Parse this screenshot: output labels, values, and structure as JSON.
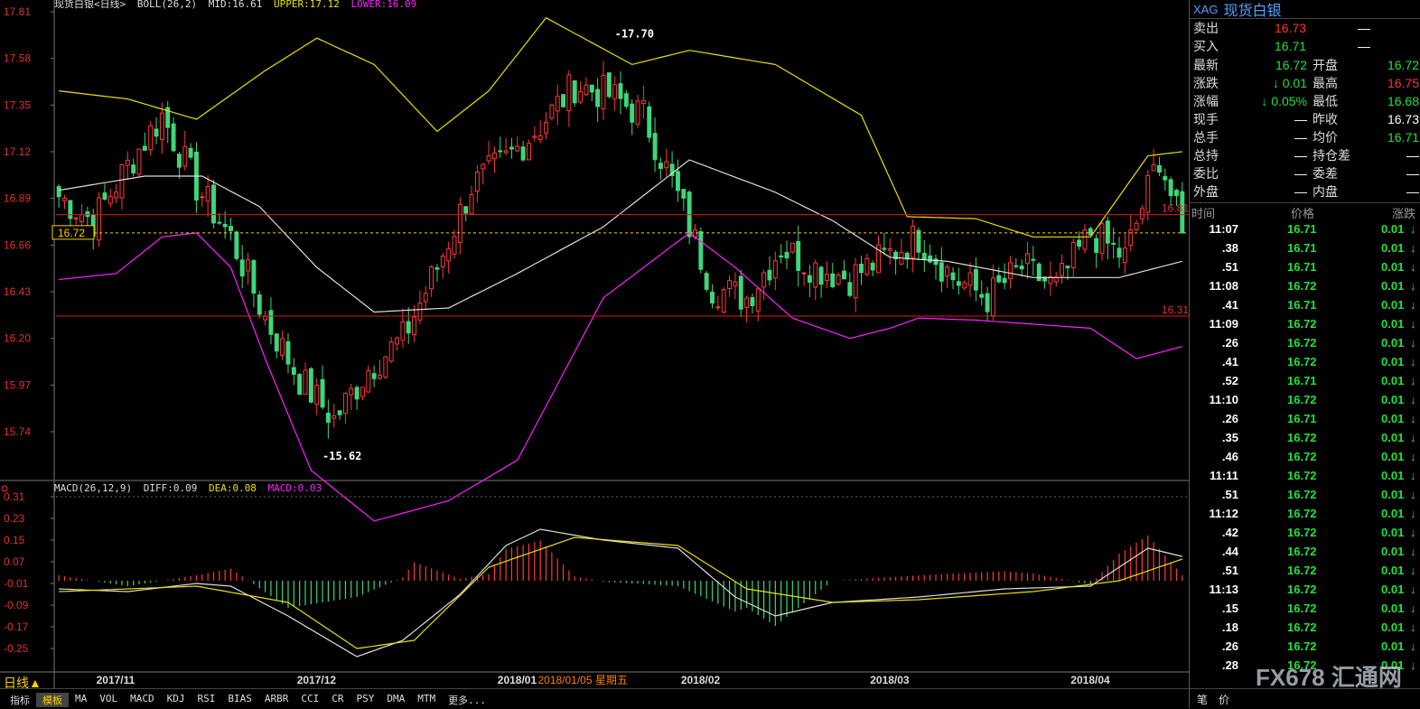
{
  "chart_header": {
    "symbol": "现货白银<日线>",
    "indicator": "BOLL(26,2)",
    "mid": "MID:16.61",
    "upper": "UPPER:17.12",
    "lower": "LOWER:16.09"
  },
  "macd_header": {
    "name": "MACD(26,12,9)",
    "diff": "DIFF:0.09",
    "dea": "DEA:0.08",
    "macd": "MACD:0.03"
  },
  "chart_data": {
    "type": "candlestick",
    "price_axis": {
      "ticks": [
        "17.81",
        "17.58",
        "17.35",
        "17.12",
        "16.89",
        "16.66",
        "16.43",
        "16.20",
        "15.97",
        "15.74"
      ],
      "range": [
        15.55,
        17.81
      ]
    },
    "macd_axis": {
      "ticks": [
        "0.31",
        "0.23",
        "0.15",
        "0.07",
        "-0.01",
        "-0.09",
        "-0.17",
        "-0.25"
      ],
      "range": [
        -0.32,
        0.31
      ]
    },
    "date_labels": [
      "2017/11",
      "2017/12",
      "2018/01",
      "2018/02",
      "2018/03",
      "2018/04"
    ],
    "cursor_date": "2018/01/05 星期五",
    "annotations": {
      "high": "17.70",
      "low": "15.62",
      "last": "16.72",
      "hline_upper": "16.81",
      "hline_lower": "16.31"
    },
    "close_anchors": [
      [
        0,
        16.9
      ],
      [
        6,
        16.78
      ],
      [
        12,
        17.05
      ],
      [
        18,
        17.3
      ],
      [
        24,
        16.95
      ],
      [
        30,
        16.7
      ],
      [
        36,
        16.3
      ],
      [
        42,
        16.0
      ],
      [
        48,
        15.8
      ],
      [
        54,
        16.05
      ],
      [
        60,
        16.2
      ],
      [
        66,
        16.55
      ],
      [
        72,
        16.95
      ],
      [
        78,
        17.08
      ],
      [
        84,
        17.25
      ],
      [
        90,
        17.45
      ],
      [
        96,
        17.4
      ],
      [
        102,
        17.3
      ],
      [
        108,
        16.9
      ],
      [
        114,
        16.45
      ],
      [
        120,
        16.4
      ],
      [
        126,
        16.65
      ],
      [
        132,
        16.55
      ],
      [
        138,
        16.5
      ],
      [
        144,
        16.6
      ],
      [
        150,
        16.7
      ],
      [
        156,
        16.5
      ],
      [
        162,
        16.4
      ],
      [
        168,
        16.55
      ],
      [
        174,
        16.45
      ],
      [
        180,
        16.72
      ],
      [
        186,
        16.6
      ],
      [
        192,
        17.1
      ],
      [
        196,
        16.72
      ]
    ],
    "upper_band": [
      [
        0,
        17.42
      ],
      [
        12,
        17.38
      ],
      [
        24,
        17.28
      ],
      [
        36,
        17.52
      ],
      [
        45,
        17.68
      ],
      [
        55,
        17.55
      ],
      [
        66,
        17.22
      ],
      [
        75,
        17.42
      ],
      [
        85,
        17.78
      ],
      [
        100,
        17.55
      ],
      [
        110,
        17.62
      ],
      [
        125,
        17.55
      ],
      [
        140,
        17.3
      ],
      [
        148,
        16.8
      ],
      [
        160,
        16.79
      ],
      [
        170,
        16.7
      ],
      [
        180,
        16.7
      ],
      [
        190,
        17.1
      ],
      [
        196,
        17.12
      ]
    ],
    "mid_band": [
      [
        0,
        16.93
      ],
      [
        15,
        17.0
      ],
      [
        25,
        17.0
      ],
      [
        35,
        16.85
      ],
      [
        45,
        16.55
      ],
      [
        55,
        16.33
      ],
      [
        68,
        16.35
      ],
      [
        80,
        16.52
      ],
      [
        95,
        16.75
      ],
      [
        110,
        17.08
      ],
      [
        125,
        16.92
      ],
      [
        135,
        16.78
      ],
      [
        145,
        16.6
      ],
      [
        155,
        16.58
      ],
      [
        170,
        16.5
      ],
      [
        185,
        16.5
      ],
      [
        196,
        16.58
      ]
    ],
    "lower_band": [
      [
        0,
        16.49
      ],
      [
        10,
        16.52
      ],
      [
        18,
        16.7
      ],
      [
        24,
        16.72
      ],
      [
        30,
        16.55
      ],
      [
        36,
        16.1
      ],
      [
        44,
        15.55
      ],
      [
        55,
        15.3
      ],
      [
        68,
        15.4
      ],
      [
        80,
        15.6
      ],
      [
        95,
        16.4
      ],
      [
        110,
        16.72
      ],
      [
        118,
        16.55
      ],
      [
        128,
        16.3
      ],
      [
        138,
        16.2
      ],
      [
        145,
        16.25
      ],
      [
        150,
        16.3
      ],
      [
        160,
        16.29
      ],
      [
        170,
        16.27
      ],
      [
        180,
        16.25
      ],
      [
        188,
        16.1
      ],
      [
        196,
        16.16
      ]
    ],
    "diff_line": [
      [
        0,
        -0.03
      ],
      [
        12,
        -0.04
      ],
      [
        24,
        -0.01
      ],
      [
        30,
        -0.02
      ],
      [
        40,
        -0.13
      ],
      [
        52,
        -0.28
      ],
      [
        60,
        -0.22
      ],
      [
        70,
        -0.05
      ],
      [
        78,
        0.13
      ],
      [
        84,
        0.19
      ],
      [
        95,
        0.15
      ],
      [
        108,
        0.12
      ],
      [
        118,
        -0.06
      ],
      [
        125,
        -0.13
      ],
      [
        135,
        -0.08
      ],
      [
        150,
        -0.06
      ],
      [
        165,
        -0.03
      ],
      [
        180,
        -0.02
      ],
      [
        190,
        0.12
      ],
      [
        196,
        0.09
      ]
    ],
    "dea_line": [
      [
        0,
        -0.04
      ],
      [
        24,
        -0.02
      ],
      [
        40,
        -0.08
      ],
      [
        52,
        -0.25
      ],
      [
        62,
        -0.22
      ],
      [
        75,
        0.05
      ],
      [
        90,
        0.16
      ],
      [
        108,
        0.13
      ],
      [
        120,
        -0.03
      ],
      [
        135,
        -0.08
      ],
      [
        150,
        -0.07
      ],
      [
        170,
        -0.04
      ],
      [
        185,
        0.0
      ],
      [
        196,
        0.08
      ]
    ]
  },
  "quote": {
    "code": "XAG",
    "name": "现货白银",
    "ask_label": "卖出",
    "ask": "16.73",
    "ask_vol": "—",
    "bid_label": "买入",
    "bid": "16.71",
    "bid_vol": "—",
    "rows": [
      {
        "l1": "最新",
        "v1": "16.72",
        "c1": "green",
        "l2": "开盘",
        "v2": "16.72",
        "c2": "green"
      },
      {
        "l1": "涨跌",
        "v1": "↓ 0.01",
        "c1": "green",
        "l2": "最高",
        "v2": "16.75",
        "c2": "red"
      },
      {
        "l1": "涨幅",
        "v1": "↓ 0.05%",
        "c1": "green",
        "l2": "最低",
        "v2": "16.68",
        "c2": "green"
      },
      {
        "l1": "现手",
        "v1": "—",
        "c1": "white",
        "l2": "昨收",
        "v2": "16.73",
        "c2": "white"
      },
      {
        "l1": "总手",
        "v1": "—",
        "c1": "white",
        "l2": "均价",
        "v2": "16.71",
        "c2": "green"
      },
      {
        "l1": "总持",
        "v1": "—",
        "c1": "white",
        "l2": "持仓差",
        "v2": "—",
        "c2": "white"
      },
      {
        "l1": "委比",
        "v1": "—",
        "c1": "white",
        "l2": "委差",
        "v2": "—",
        "c2": "white"
      },
      {
        "l1": "外盘",
        "v1": "—",
        "c1": "white",
        "l2": "内盘",
        "v2": "—",
        "c2": "white"
      }
    ]
  },
  "ticks_header": {
    "time": "时间",
    "price": "价格",
    "change": "涨跌"
  },
  "ticks": [
    {
      "t": "11:07",
      "p": "16.71",
      "c": "0.01"
    },
    {
      "t": ".38",
      "p": "16.71",
      "c": "0.01"
    },
    {
      "t": ".51",
      "p": "16.71",
      "c": "0.01"
    },
    {
      "t": "11:08",
      "p": "16.72",
      "c": "0.01"
    },
    {
      "t": ".41",
      "p": "16.71",
      "c": "0.01"
    },
    {
      "t": "11:09",
      "p": "16.72",
      "c": "0.01"
    },
    {
      "t": ".26",
      "p": "16.72",
      "c": "0.01"
    },
    {
      "t": ".41",
      "p": "16.72",
      "c": "0.01"
    },
    {
      "t": ".52",
      "p": "16.71",
      "c": "0.01"
    },
    {
      "t": "11:10",
      "p": "16.72",
      "c": "0.01"
    },
    {
      "t": ".26",
      "p": "16.71",
      "c": "0.01"
    },
    {
      "t": ".35",
      "p": "16.72",
      "c": "0.01"
    },
    {
      "t": ".46",
      "p": "16.72",
      "c": "0.01"
    },
    {
      "t": "11:11",
      "p": "16.72",
      "c": "0.01"
    },
    {
      "t": ".51",
      "p": "16.72",
      "c": "0.01"
    },
    {
      "t": "11:12",
      "p": "16.72",
      "c": "0.01"
    },
    {
      "t": ".42",
      "p": "16.72",
      "c": "0.01"
    },
    {
      "t": ".44",
      "p": "16.72",
      "c": "0.01"
    },
    {
      "t": ".51",
      "p": "16.72",
      "c": "0.01"
    },
    {
      "t": "11:13",
      "p": "16.72",
      "c": "0.01"
    },
    {
      "t": ".15",
      "p": "16.72",
      "c": "0.01"
    },
    {
      "t": ".18",
      "p": "16.72",
      "c": "0.01"
    },
    {
      "t": ".26",
      "p": "16.72",
      "c": "0.01"
    },
    {
      "t": ".28",
      "p": "16.72",
      "c": "0.01"
    }
  ],
  "bottom": {
    "period": "日线▲",
    "tabs": [
      "指标",
      "模板",
      "MA",
      "VOL",
      "MACD",
      "KDJ",
      "RSI",
      "BIAS",
      "ARBR",
      "CCI",
      "CR",
      "PSY",
      "DMA",
      "MTM",
      "更多..."
    ],
    "panel_tabs": [
      "笔",
      "价"
    ]
  },
  "logo": {
    "text": "FX678 汇通网"
  },
  "colors": {
    "up": "#ff3838",
    "down": "#3ed67a",
    "upper": "#e8e000",
    "mid": "#dddddd",
    "lower": "#ff20ff",
    "hline": "#e01818"
  }
}
